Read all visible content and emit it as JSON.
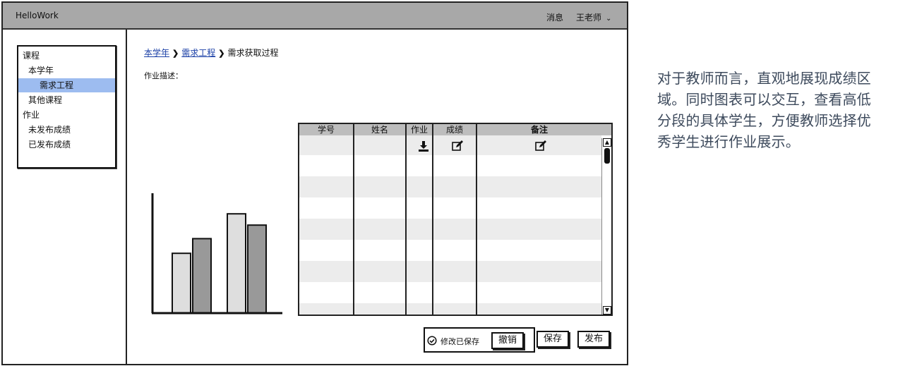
{
  "topbar": {
    "app_title": "HelloWork",
    "messages_link": "消息",
    "user_name": "王老师"
  },
  "sidebar": {
    "items": [
      {
        "label": "课程",
        "level": 0,
        "selected": false
      },
      {
        "label": "本学年",
        "level": 1,
        "selected": false
      },
      {
        "label": "需求工程",
        "level": 2,
        "selected": true
      },
      {
        "label": "其他课程",
        "level": 1,
        "selected": false
      },
      {
        "label": "作业",
        "level": 0,
        "selected": false
      },
      {
        "label": "未发布成绩",
        "level": 1,
        "selected": false
      },
      {
        "label": "已发布成绩",
        "level": 1,
        "selected": false
      }
    ]
  },
  "breadcrumb": {
    "items": [
      "本学年",
      "需求工程",
      "需求获取过程"
    ]
  },
  "main": {
    "description_label": "作业描述："
  },
  "chart_data": {
    "type": "bar",
    "title": "",
    "xlabel": "",
    "ylabel": "",
    "categories": [
      "",
      ""
    ],
    "series": [
      {
        "values": [
          0.53,
          0.88
        ],
        "color": "#dedede"
      },
      {
        "values": [
          0.66,
          0.78
        ],
        "color": "#999999"
      }
    ],
    "ylim": [
      0,
      1
    ],
    "grid": false
  },
  "table": {
    "columns": [
      "学号",
      "姓名",
      "作业",
      "成绩",
      "备注"
    ],
    "row_icons": {
      "homework": "download-icon",
      "grade": "edit-icon",
      "remark": "edit-icon"
    }
  },
  "actions": {
    "save_status": "修改已保存",
    "undo_button": "撤销",
    "save_button": "保存",
    "publish_button": "发布"
  },
  "annotation": {
    "lines": [
      "对于教师而言，直观地展现成绩区",
      "域。同时图表可以交互，查看高低",
      "分段的具体学生，方便教师选择优",
      "秀学生进行作业展示。"
    ]
  },
  "colors": {
    "topbar": "#a8a8a8",
    "selected_nav": "#9dbcf0",
    "link": "#1a3fa6",
    "annotation_text": "#3d4a5c"
  }
}
